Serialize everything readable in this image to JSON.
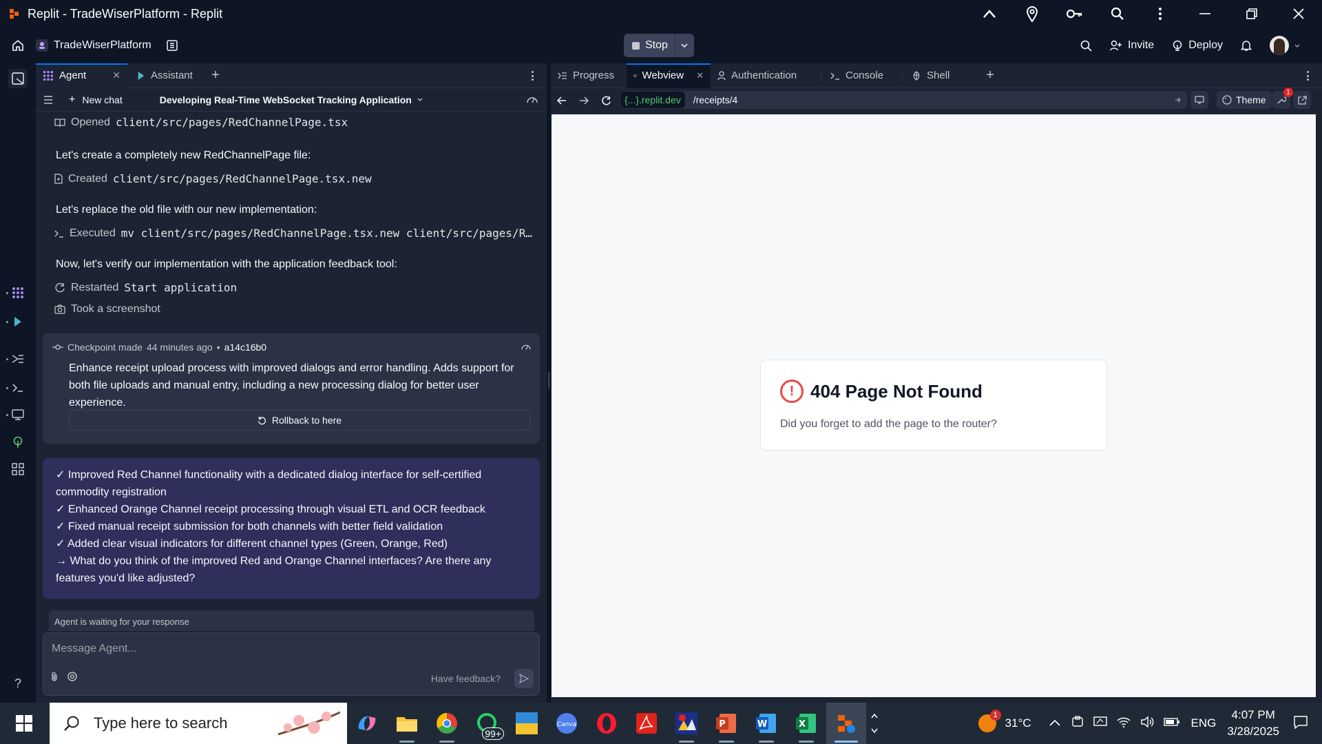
{
  "window": {
    "title": "Replit - TradeWiserPlatform - Replit"
  },
  "header": {
    "project_name": "TradeWiserPlatform",
    "stop_label": "Stop",
    "invite_label": "Invite",
    "deploy_label": "Deploy"
  },
  "left_tabs": [
    {
      "label": "Agent",
      "active": true
    },
    {
      "label": "Assistant",
      "active": false
    }
  ],
  "chat": {
    "new_chat_label": "New chat",
    "title": "Developing Real-Time WebSocket Tracking Application",
    "actions": [
      {
        "verb": "Opened",
        "target": "client/src/pages/RedChannelPage.tsx",
        "icon": "book-icon"
      },
      {
        "verb": "Created",
        "target": "client/src/pages/RedChannelPage.tsx.new",
        "icon": "file-icon"
      },
      {
        "verb": "Executed",
        "target": "mv client/src/pages/RedChannelPage.tsx.new client/src/pages/R…",
        "icon": "terminal-icon"
      },
      {
        "verb": "Restarted",
        "target": "Start application",
        "icon": "restart-icon"
      },
      {
        "verb": "Took a screenshot",
        "target": "",
        "icon": "camera-icon"
      }
    ],
    "messages": [
      "Let's create a completely new RedChannelPage file:",
      "Let's replace the old file with our new implementation:",
      "Now, let's verify our implementation with the application feedback tool:"
    ],
    "checkpoint": {
      "label": "Checkpoint made",
      "time": "44 minutes ago",
      "hash": "a14c16b0",
      "body": "Enhance receipt upload process with improved dialogs and error handling. Adds support for both file uploads and manual entry, including a new processing dialog for better user experience.",
      "rollback_label": "Rollback to here"
    },
    "summary": [
      "✓ Improved Red Channel functionality with a dedicated dialog interface for self-certified commodity registration",
      "✓ Enhanced Orange Channel receipt processing through visual ETL and OCR feedback",
      "✓ Fixed manual receipt submission for both channels with better field validation",
      "✓ Added clear visual indicators for different channel types (Green, Orange, Red)",
      "→ What do you think of the improved Red and Orange Channel interfaces? Are there any features you'd like adjusted?"
    ],
    "waiting_text": "Agent is waiting for your response",
    "input_placeholder": "Message Agent...",
    "feedback_label": "Have feedback?"
  },
  "right_tabs": [
    {
      "label": "Progress",
      "icon": "progress-icon"
    },
    {
      "label": "Webview",
      "icon": "monitor-icon",
      "active": true
    },
    {
      "label": "Authentication",
      "icon": "user-icon"
    },
    {
      "label": "Console",
      "icon": "terminal-icon"
    },
    {
      "label": "Shell",
      "icon": "shell-icon"
    }
  ],
  "webview": {
    "domain_braces": "{...}",
    "domain": ".replit.dev",
    "path": "/receipts/4",
    "theme_label": "Theme",
    "notification_count": "1",
    "error_title": "404 Page Not Found",
    "error_desc": "Did you forget to add the page to the router?"
  },
  "taskbar": {
    "search_placeholder": "Type here to search",
    "whatsapp_badge": "99+",
    "weather_badge": "1",
    "temperature": "31°C",
    "language": "ENG",
    "time": "4:07 PM",
    "date": "3/28/2025"
  },
  "colors": {
    "accent": "#0079f2",
    "bg_dark": "#0e1525",
    "panel": "#1c2333",
    "summary_bg": "#2e2f5b"
  }
}
